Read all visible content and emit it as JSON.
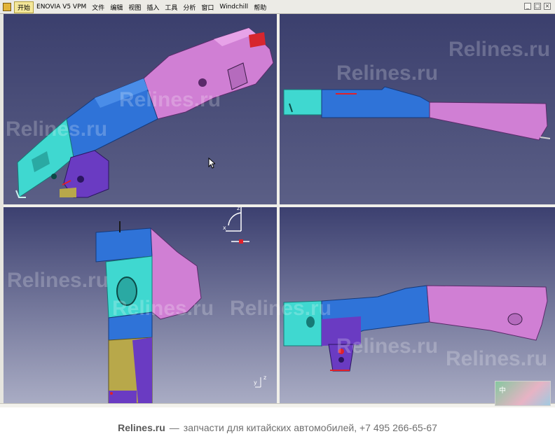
{
  "menubar": {
    "items": [
      "开始",
      "ENOVIA V5 VPM",
      "文件",
      "编辑",
      "视图",
      "插入",
      "工具",
      "分析",
      "窗口",
      "Windchill",
      "帮助"
    ],
    "active_item": "开始"
  },
  "viewports": {
    "layout": "2x2",
    "background_color": "#3e4370",
    "views": [
      "isometric",
      "side",
      "front",
      "top"
    ]
  },
  "compass": {
    "axis_x": "x",
    "axis_z": "z"
  },
  "mini_axis": {
    "axis_y": "y",
    "axis_z": "z"
  },
  "watermark": {
    "text": "Relines.ru"
  },
  "thumbnail": {
    "ime": "中"
  },
  "footer": {
    "brand": "Relines.ru",
    "dash": "—",
    "tagline": "запчасти для китайских автомобилей, +7 495 266-65-67"
  },
  "colors": {
    "part_cyan": "#3fd8d0",
    "part_blue": "#2f73d8",
    "part_pink": "#d884d8",
    "part_purple": "#6a3bc2",
    "part_olive": "#b8a84a",
    "part_red": "#e0202a"
  }
}
